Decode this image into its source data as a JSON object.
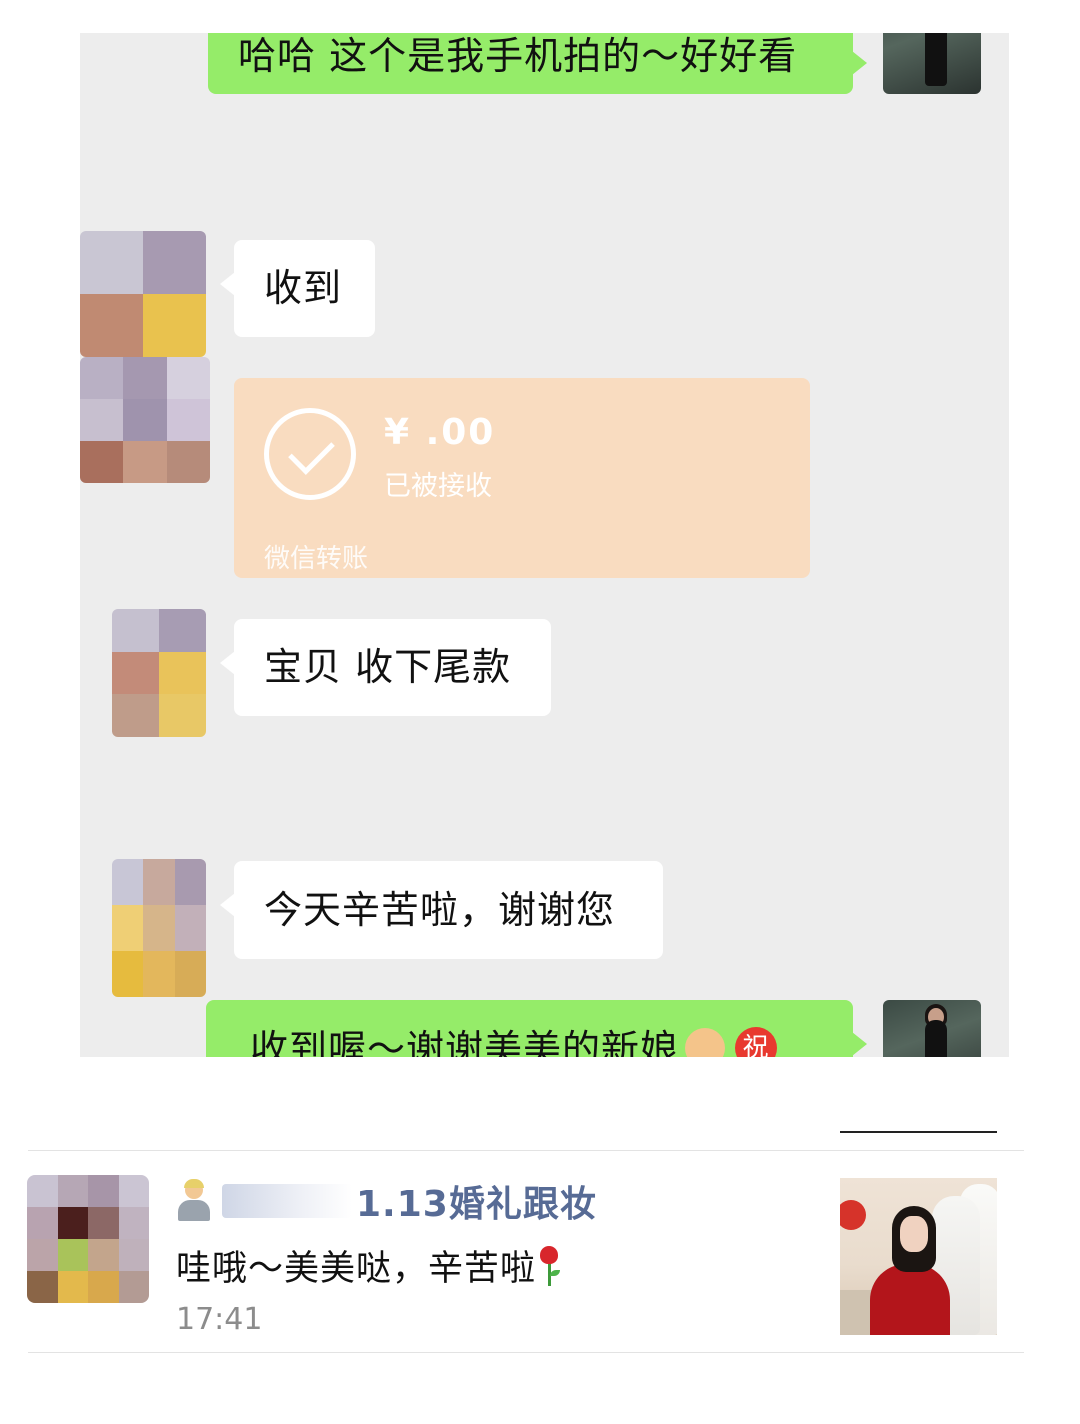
{
  "chat": {
    "messages": [
      {
        "from": "me",
        "text": "哈哈 这个是我手机拍的～好好看"
      },
      {
        "from": "other",
        "text": "收到"
      },
      {
        "from": "other",
        "type": "transfer",
        "amount": "¥ .00",
        "status": "已被接收",
        "brand": "微信转账"
      },
      {
        "from": "other",
        "text": "宝贝 收下尾款"
      },
      {
        "from": "other",
        "text": "今天辛苦啦，谢谢您"
      },
      {
        "from": "me",
        "text": "收到喔～谢谢美美的新娘",
        "emojis": [
          "bride-emoji",
          "congratulations-emoji"
        ],
        "emoji_zhu": "祝"
      }
    ]
  },
  "moment": {
    "name": "1.13婚礼跟妆",
    "text": "哇哦～美美哒，辛苦啦",
    "time": "17:41"
  },
  "colors": {
    "chat_bg": "#ededed",
    "green_bubble": "#95ec69",
    "transfer_bg": "#f9dcc0",
    "name_blue": "#576b95",
    "time_gray": "#8c8c8c"
  }
}
